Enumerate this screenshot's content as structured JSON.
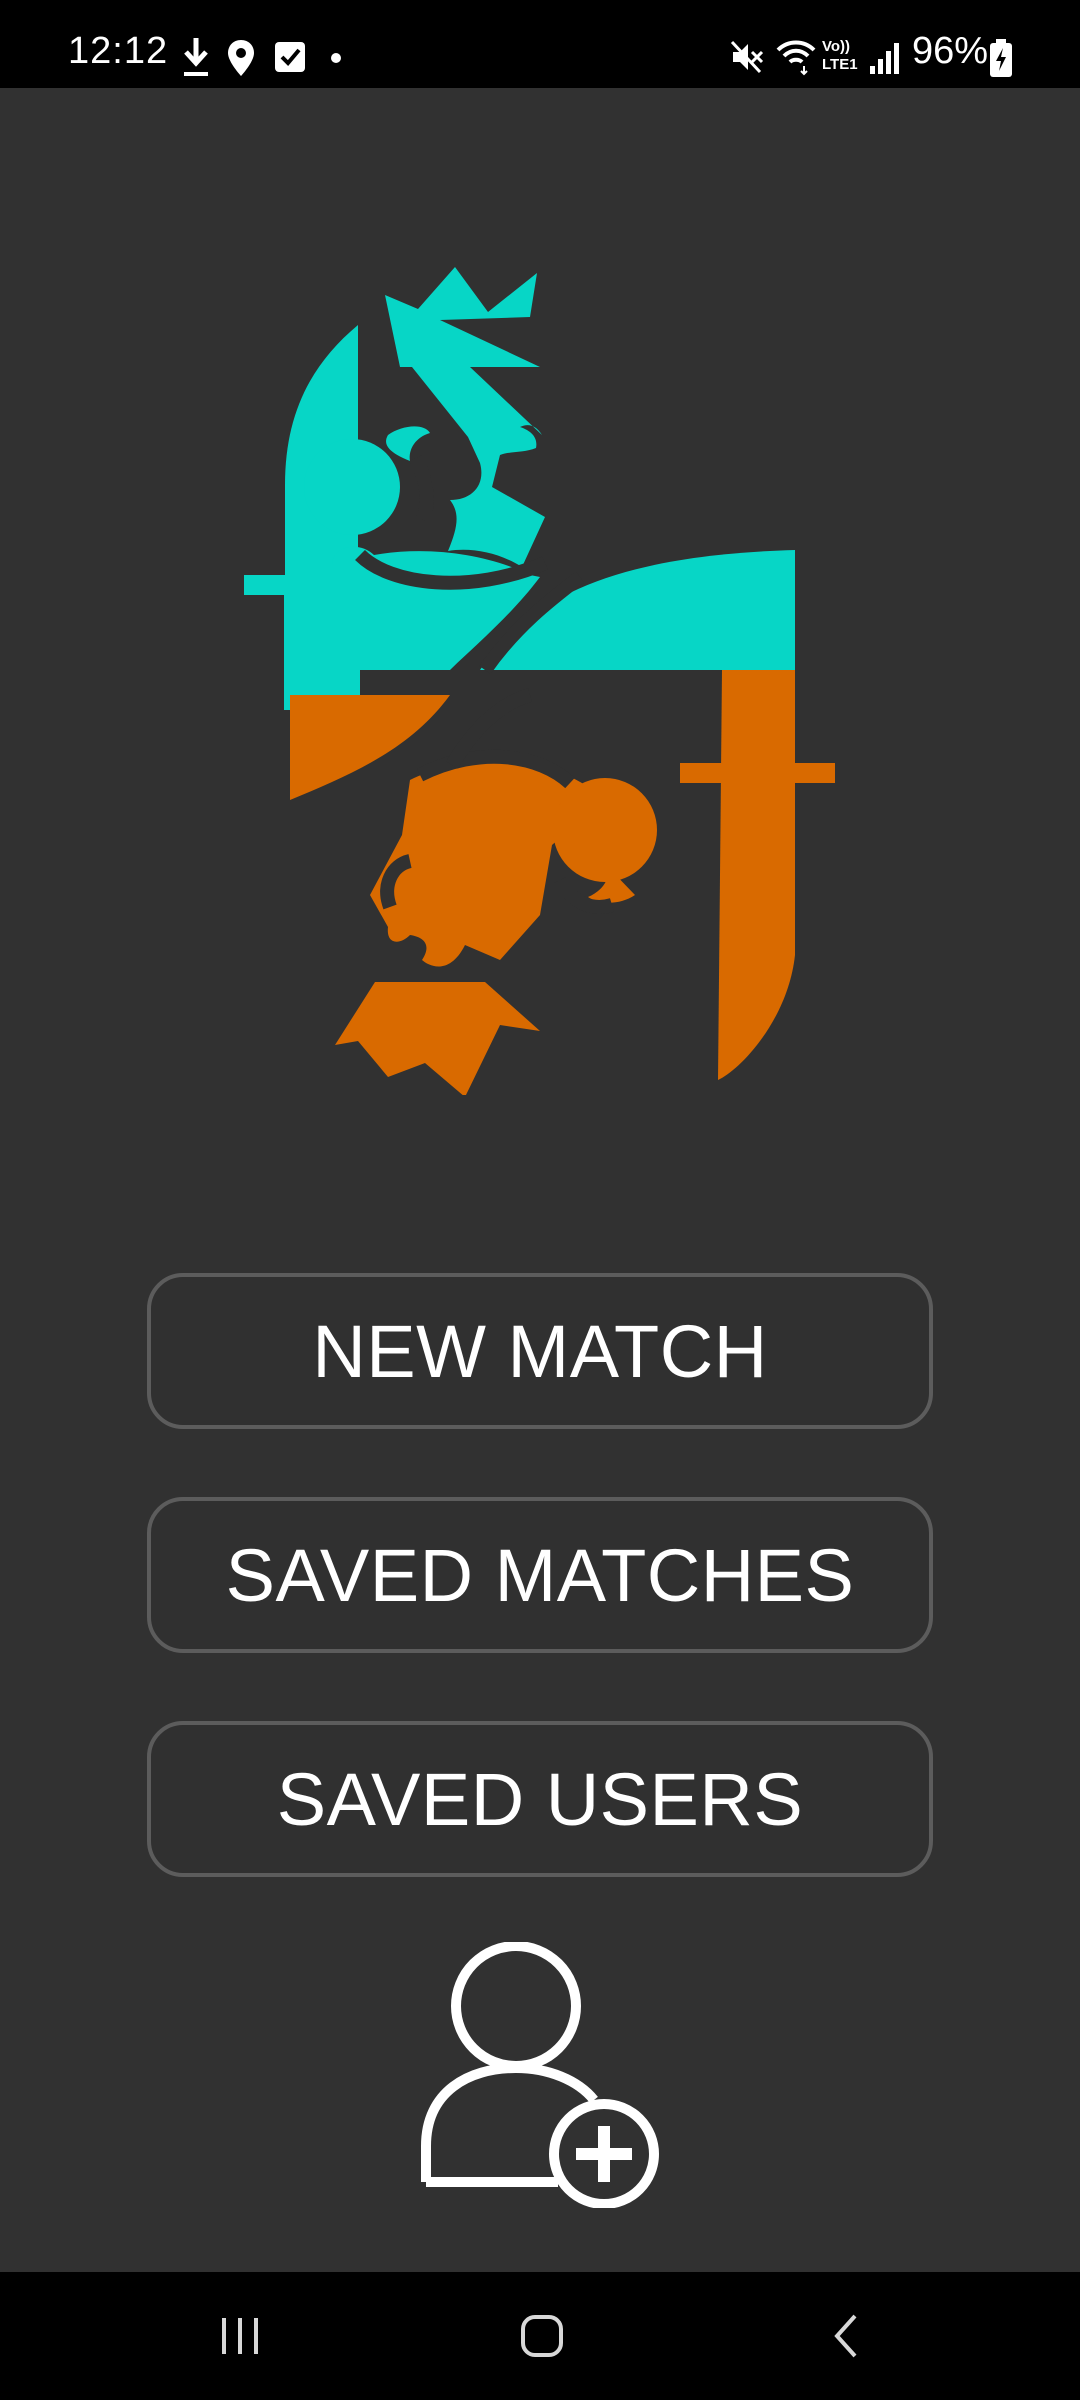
{
  "status_bar": {
    "time": "12:12",
    "battery_percent": "96%",
    "left_icons": [
      "download-icon",
      "location-icon",
      "checkbox-icon",
      "dot-icon"
    ],
    "right_icons": [
      "mute-icon",
      "wifi-icon",
      "volte-icon",
      "signal-icon",
      "battery-charging-icon"
    ],
    "volte_label_top": "Vo))",
    "volte_label_bottom": "LTE1"
  },
  "logo": {
    "icon": "king-card-logo",
    "colors": {
      "top": "#07d6c6",
      "bottom": "#d96a00"
    }
  },
  "menu": {
    "new_match": "NEW MATCH",
    "saved_matches": "SAVED MATCHES",
    "saved_users": "SAVED USERS"
  },
  "add_user": {
    "icon": "add-user-icon"
  },
  "nav_bar": {
    "icons": [
      "recent-apps-icon",
      "home-icon",
      "back-icon"
    ]
  },
  "colors": {
    "background": "#313131",
    "button_border": "#5c5c5c",
    "text": "#ffffff"
  }
}
